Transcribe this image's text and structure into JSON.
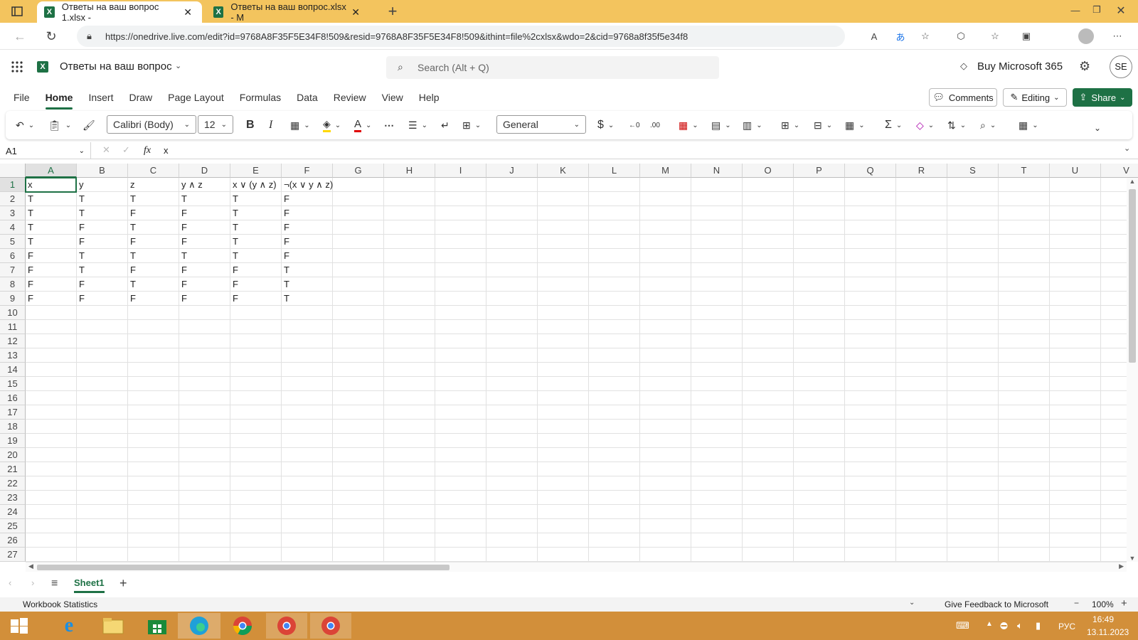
{
  "browser": {
    "tabs": [
      {
        "label": "Ответы на ваш вопрос 1.xlsx -"
      },
      {
        "label": "Ответы на ваш вопрос.xlsx - M"
      }
    ],
    "url": "https://onedrive.live.com/edit?id=9768A8F35F5E34F8!509&resid=9768A8F35F5E34F8!509&ithint=file%2cxlsx&wdo=2&cid=9768a8f35f5e34f8"
  },
  "app": {
    "doc_title": "Ответы на ваш вопрос",
    "search_placeholder": "Search (Alt + Q)",
    "buy_label": "Buy Microsoft 365",
    "avatar_initials": "SE"
  },
  "ribbon": {
    "tabs": [
      "File",
      "Home",
      "Insert",
      "Draw",
      "Page Layout",
      "Formulas",
      "Data",
      "Review",
      "View",
      "Help"
    ],
    "active_tab": "Home",
    "comments_label": "Comments",
    "editing_label": "Editing",
    "share_label": "Share",
    "font_name": "Calibri (Body)",
    "font_size": "12",
    "number_format": "General"
  },
  "formula_bar": {
    "name_box": "A1",
    "fx_label": "fx",
    "content": "x"
  },
  "sheet": {
    "columns": [
      "A",
      "B",
      "C",
      "D",
      "E",
      "F",
      "G",
      "H",
      "I",
      "J",
      "K",
      "L",
      "M",
      "N",
      "O",
      "P",
      "Q",
      "R",
      "S",
      "T",
      "U",
      "V"
    ],
    "row_numbers": [
      "1",
      "2",
      "3",
      "4",
      "5",
      "6",
      "7",
      "8",
      "9",
      "10",
      "11",
      "12",
      "13",
      "14",
      "15",
      "16",
      "17",
      "18",
      "19",
      "20",
      "21",
      "22",
      "23",
      "24",
      "25",
      "26",
      "27"
    ],
    "selected_cell": "A1",
    "rows": [
      [
        "x",
        "y",
        "z",
        "y ∧ z",
        "x ∨ (y ∧ z)",
        "¬(x ∨ y ∧ z)"
      ],
      [
        "T",
        "T",
        "T",
        "T",
        "T",
        "F"
      ],
      [
        "T",
        "T",
        "F",
        "F",
        "T",
        "F"
      ],
      [
        "T",
        "F",
        "T",
        "F",
        "T",
        "F"
      ],
      [
        "T",
        "F",
        "F",
        "F",
        "T",
        "F"
      ],
      [
        "F",
        "T",
        "T",
        "T",
        "T",
        "F"
      ],
      [
        "F",
        "T",
        "F",
        "F",
        "F",
        "T"
      ],
      [
        "F",
        "F",
        "T",
        "F",
        "F",
        "T"
      ],
      [
        "F",
        "F",
        "F",
        "F",
        "F",
        "T"
      ]
    ]
  },
  "sheet_tabs": {
    "active": "Sheet1"
  },
  "status": {
    "left": "Workbook Statistics",
    "feedback": "Give Feedback to Microsoft",
    "zoom": "100%"
  },
  "taskbar": {
    "lang": "РУС",
    "time": "16:49",
    "date": "13.11.2023"
  }
}
